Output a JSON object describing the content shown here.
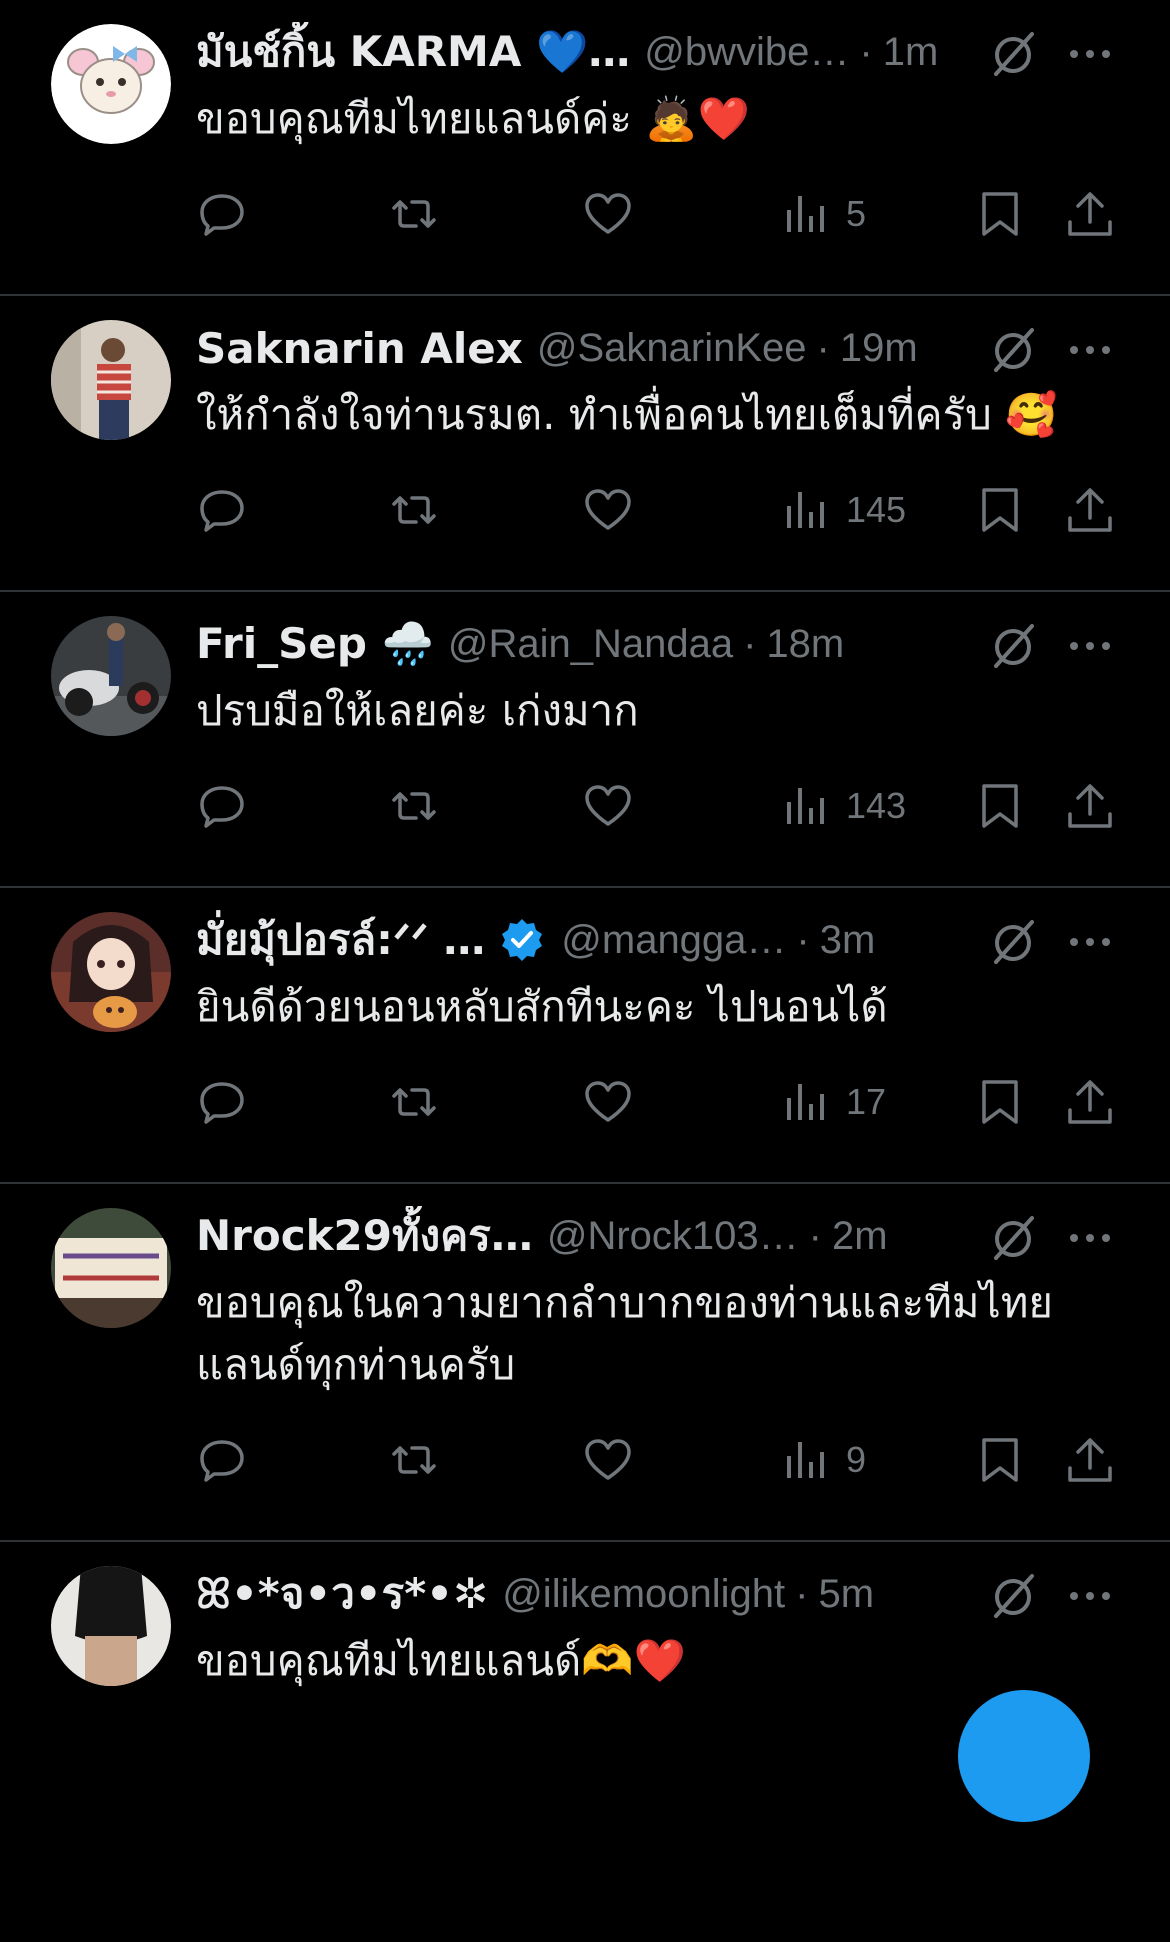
{
  "colors": {
    "background": "#000000",
    "text_primary": "#e7e9ea",
    "text_secondary": "#71767b",
    "divider": "#2f3336",
    "verified_blue": "#1d9bf0"
  },
  "tweets": [
    {
      "display_name": "มันช์กิ้น KARMA 💙…",
      "handle": "@bwvibe…",
      "time": "1m",
      "text": "ขอบคุณทีมไทยแลนด์ค่ะ 🙇❤️",
      "views": "5",
      "avatar_icon": "hamster-cartoon-avatar"
    },
    {
      "display_name": "Saknarin Alex",
      "handle": "@SaknarinKee",
      "time": "19m",
      "text": "ให้กำลังใจท่านรมต. ทำเพื่อคนไทยเต็มที่ครับ 🥰",
      "views": "145",
      "avatar_icon": "person-photo-avatar"
    },
    {
      "display_name": "Fri_Sep 🌧️",
      "handle": "@Rain_Nandaa",
      "time": "18m",
      "text": "ปรบมือให้เลยค่ะ เก่งมาก",
      "views": "143",
      "avatar_icon": "motorbike-photo-avatar"
    },
    {
      "display_name": "มั่ยมุ้ปอรล์:ᐟᐟ …",
      "handle": "@mangga…",
      "time": "3m",
      "text": "ยินดีด้วยนอนหลับสักทีนะคะ ไปนอนได้",
      "views": "17",
      "verified": true,
      "avatar_icon": "anime-girl-avatar"
    },
    {
      "display_name": "Nrock29ทั้งคร…",
      "handle": "@Nrock103…",
      "time": "2m",
      "text": "ขอบคุณในความยากลำบากของท่านและทีมไทยแลนด์ทุกท่านครับ",
      "views": "9",
      "avatar_icon": "protest-sign-avatar"
    },
    {
      "display_name": "ꕤ•*จ•ว•ร*•✲",
      "handle": "@ilikemoonlight",
      "time": "5m",
      "text": "ขอบคุณทีมไทยแลนด์🫶❤️",
      "views": "",
      "avatar_icon": "person-black-top-avatar"
    }
  ]
}
